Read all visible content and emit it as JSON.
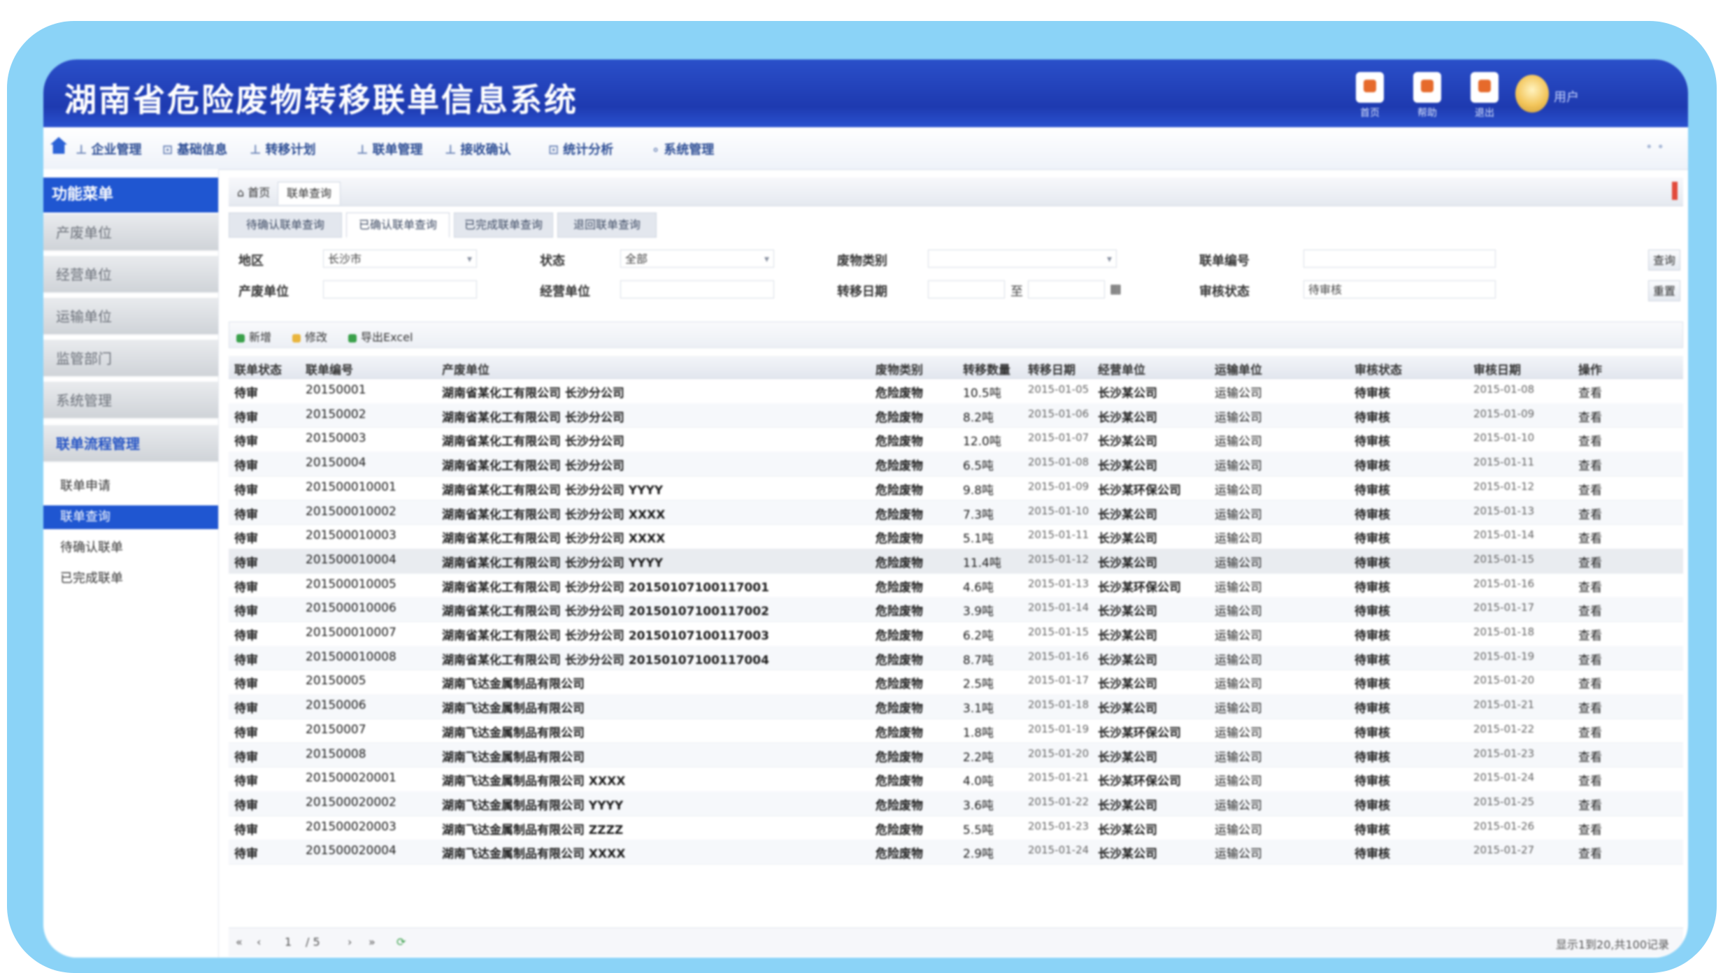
{
  "app": {
    "title": "湖南省危险废物转移联单信息系统",
    "header_buttons": [
      {
        "label": "首页",
        "icon": "home-doc-icon"
      },
      {
        "label": "帮助",
        "icon": "help-doc-icon"
      },
      {
        "label": "退出",
        "icon": "exit-doc-icon"
      }
    ],
    "user_label": "用户"
  },
  "toolbar": {
    "items": [
      "企业管理",
      "基础信息",
      "转移计划",
      "联单管理",
      "接收确认",
      "统计分析",
      "系统管理"
    ]
  },
  "sidebar": {
    "head": "功能菜单",
    "groups": [
      "产废单位",
      "经营单位",
      "运输单位",
      "监管部门",
      "系统管理",
      "联单流程管理"
    ],
    "subitems": [
      "联单申请",
      "联单查询",
      "待确认联单",
      "已完成联单"
    ],
    "selected_index": 1
  },
  "tabs": {
    "home": "首页",
    "current": "联单查询"
  },
  "subtabs": [
    "待确认联单查询",
    "已确认联单查询",
    "已完成联单查询",
    "退回联单查询"
  ],
  "filters": {
    "row1": [
      {
        "label": "地区",
        "value": "长沙市",
        "type": "select"
      },
      {
        "label": "状态",
        "value": "全部",
        "type": "select"
      },
      {
        "label": "废物类别",
        "value": "",
        "type": "select"
      },
      {
        "label": "联单编号",
        "value": "",
        "type": "text"
      }
    ],
    "row2": [
      {
        "label": "产废单位",
        "value": "",
        "type": "text"
      },
      {
        "label": "经营单位",
        "value": "",
        "type": "text"
      },
      {
        "label": "转移日期",
        "value_from": "",
        "value_to": "",
        "sep": "至"
      },
      {
        "label": "审核状态",
        "value": "待审核",
        "type": "text"
      }
    ],
    "buttons": [
      "查询",
      "重置"
    ]
  },
  "grid_toolbar": {
    "buttons": [
      {
        "label": "新增",
        "color": "#3aa04a"
      },
      {
        "label": "修改",
        "color": "#e9b53d"
      },
      {
        "label": "导出Excel",
        "color": "#3aa04a"
      }
    ]
  },
  "grid": {
    "columns": [
      "联单状态",
      "联单编号",
      "产废单位",
      "废物类别",
      "转移数量",
      "转移日期",
      "经营单位",
      "运输单位",
      "审核状态",
      "审核日期",
      "操作"
    ],
    "rows": [
      [
        "待审",
        "20150001",
        "湖南省某化工有限公司 长沙分公司",
        "危险废物",
        "10.5吨",
        "2015-01-05",
        "长沙某公司",
        "运输公司",
        "待审核",
        "2015-01-08",
        "查看"
      ],
      [
        "待审",
        "20150002",
        "湖南省某化工有限公司 长沙分公司",
        "危险废物",
        "8.2吨",
        "2015-01-06",
        "长沙某公司",
        "运输公司",
        "待审核",
        "2015-01-09",
        "查看"
      ],
      [
        "待审",
        "20150003",
        "湖南省某化工有限公司 长沙分公司",
        "危险废物",
        "12.0吨",
        "2015-01-07",
        "长沙某公司",
        "运输公司",
        "待审核",
        "2015-01-10",
        "查看"
      ],
      [
        "待审",
        "20150004",
        "湖南省某化工有限公司 长沙分公司",
        "危险废物",
        "6.5吨",
        "2015-01-08",
        "长沙某公司",
        "运输公司",
        "待审核",
        "2015-01-11",
        "查看"
      ],
      [
        "待审",
        "201500010001",
        "湖南省某化工有限公司 长沙分公司 YYYY",
        "危险废物",
        "9.8吨",
        "2015-01-09",
        "长沙某环保公司",
        "运输公司",
        "待审核",
        "2015-01-12",
        "查看"
      ],
      [
        "待审",
        "201500010002",
        "湖南省某化工有限公司 长沙分公司 XXXX",
        "危险废物",
        "7.3吨",
        "2015-01-10",
        "长沙某公司",
        "运输公司",
        "待审核",
        "2015-01-13",
        "查看"
      ],
      [
        "待审",
        "201500010003",
        "湖南省某化工有限公司 长沙分公司 XXXX",
        "危险废物",
        "5.1吨",
        "2015-01-11",
        "长沙某公司",
        "运输公司",
        "待审核",
        "2015-01-14",
        "查看"
      ],
      [
        "待审",
        "201500010004",
        "湖南省某化工有限公司 长沙分公司 YYYY",
        "危险废物",
        "11.4吨",
        "2015-01-12",
        "长沙某公司",
        "运输公司",
        "待审核",
        "2015-01-15",
        "查看"
      ],
      [
        "待审",
        "201500010005",
        "湖南省某化工有限公司 长沙分公司 20150107100117001",
        "危险废物",
        "4.6吨",
        "2015-01-13",
        "长沙某环保公司",
        "运输公司",
        "待审核",
        "2015-01-16",
        "查看"
      ],
      [
        "待审",
        "201500010006",
        "湖南省某化工有限公司 长沙分公司 20150107100117002",
        "危险废物",
        "3.9吨",
        "2015-01-14",
        "长沙某公司",
        "运输公司",
        "待审核",
        "2015-01-17",
        "查看"
      ],
      [
        "待审",
        "201500010007",
        "湖南省某化工有限公司 长沙分公司 20150107100117003",
        "危险废物",
        "6.2吨",
        "2015-01-15",
        "长沙某公司",
        "运输公司",
        "待审核",
        "2015-01-18",
        "查看"
      ],
      [
        "待审",
        "201500010008",
        "湖南省某化工有限公司 长沙分公司 20150107100117004",
        "危险废物",
        "8.7吨",
        "2015-01-16",
        "长沙某公司",
        "运输公司",
        "待审核",
        "2015-01-19",
        "查看"
      ],
      [
        "待审",
        "20150005",
        "湖南飞达金属制品有限公司",
        "危险废物",
        "2.5吨",
        "2015-01-17",
        "长沙某公司",
        "运输公司",
        "待审核",
        "2015-01-20",
        "查看"
      ],
      [
        "待审",
        "20150006",
        "湖南飞达金属制品有限公司",
        "危险废物",
        "3.1吨",
        "2015-01-18",
        "长沙某公司",
        "运输公司",
        "待审核",
        "2015-01-21",
        "查看"
      ],
      [
        "待审",
        "20150007",
        "湖南飞达金属制品有限公司",
        "危险废物",
        "1.8吨",
        "2015-01-19",
        "长沙某环保公司",
        "运输公司",
        "待审核",
        "2015-01-22",
        "查看"
      ],
      [
        "待审",
        "20150008",
        "湖南飞达金属制品有限公司",
        "危险废物",
        "2.2吨",
        "2015-01-20",
        "长沙某公司",
        "运输公司",
        "待审核",
        "2015-01-23",
        "查看"
      ],
      [
        "待审",
        "201500020001",
        "湖南飞达金属制品有限公司 XXXX",
        "危险废物",
        "4.0吨",
        "2015-01-21",
        "长沙某环保公司",
        "运输公司",
        "待审核",
        "2015-01-24",
        "查看"
      ],
      [
        "待审",
        "201500020002",
        "湖南飞达金属制品有限公司 YYYY",
        "危险废物",
        "3.6吨",
        "2015-01-22",
        "长沙某公司",
        "运输公司",
        "待审核",
        "2015-01-25",
        "查看"
      ],
      [
        "待审",
        "201500020003",
        "湖南飞达金属制品有限公司 ZZZZ",
        "危险废物",
        "5.5吨",
        "2015-01-23",
        "长沙某公司",
        "运输公司",
        "待审核",
        "2015-01-26",
        "查看"
      ],
      [
        "待审",
        "201500020004",
        "湖南飞达金属制品有限公司 XXXX",
        "危险废物",
        "2.9吨",
        "2015-01-24",
        "长沙某公司",
        "运输公司",
        "待审核",
        "2015-01-27",
        "查看"
      ]
    ],
    "highlight_row": 7
  },
  "pager": {
    "first": "«",
    "prev": "‹",
    "page": "1",
    "of": "/ 5",
    "next": "›",
    "last": "»",
    "refresh": "⟳",
    "summary": "显示1到20,共100记录"
  }
}
